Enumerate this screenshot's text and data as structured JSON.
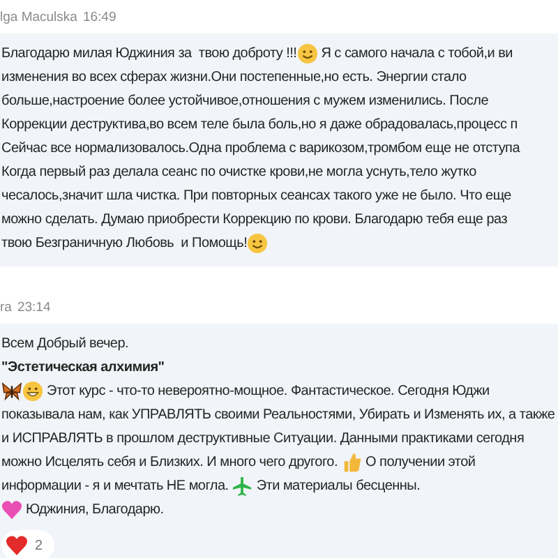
{
  "messages": [
    {
      "sender": "lga Maculska",
      "time": "16:49",
      "lines": [
        [
          {
            "kind": "text",
            "text": "Благодарю милая Юджиния за  твою доброту !!!"
          },
          {
            "kind": "smiley"
          },
          {
            "kind": "text",
            "text": " Я с самого начала с тобой,и ви"
          }
        ],
        [
          {
            "kind": "text",
            "text": "изменения во всех сферах жизни.Они постепенные,но есть. Энергии стало"
          }
        ],
        [
          {
            "kind": "text",
            "text": "больше,настроение более устойчивое,отношения с мужем изменились. После"
          }
        ],
        [
          {
            "kind": "text",
            "text": "Коррекции деструктива,во всем теле была боль,но я даже обрадовалась,процесс п"
          }
        ],
        [
          {
            "kind": "text",
            "text": "Сейчас все нормализовалось.Одна проблема с варикозом,тромбом еще не отступа"
          }
        ],
        [
          {
            "kind": "text",
            "text": "Когда первый раз делала сеанс по очистке крови,не могла уснуть,тело жутко"
          }
        ],
        [
          {
            "kind": "text",
            "text": "чесалось,значит шла чистка. При повторных сеансах такого уже не было. Что еще"
          }
        ],
        [
          {
            "kind": "text",
            "text": "можно сделать. Думаю приобрести Коррекцию по крови. Благодарю тебя еще раз"
          }
        ],
        [
          {
            "kind": "text",
            "text": "твою Безграничную Любовь  и Помощь!"
          },
          {
            "kind": "smiley"
          }
        ]
      ]
    },
    {
      "sender": "ra",
      "time": "23:14",
      "lines": [
        [
          {
            "kind": "text",
            "text": "Всем Добрый вечер."
          }
        ],
        [
          {
            "kind": "bold",
            "text": "\"Эстетическая алхимия\""
          }
        ],
        [
          {
            "kind": "butterfly"
          },
          {
            "kind": "grin"
          },
          {
            "kind": "text",
            "text": " Этот курс - что-то невероятно-мощное. Фантастическое. Сегодня Юджи"
          }
        ],
        [
          {
            "kind": "text",
            "text": "показывала нам, как УПРАВЛЯТЬ своими Реальностями, Убирать и Изменять их, а также"
          }
        ],
        [
          {
            "kind": "text",
            "text": "и ИСПРАВЛЯТЬ в прошлом деструктивные Ситуации. Данными практиками сегодня"
          }
        ],
        [
          {
            "kind": "text",
            "text": "можно Исцелять себя и Близких. И много чего другого. "
          },
          {
            "kind": "thumbsup"
          },
          {
            "kind": "text",
            "text": " О получении этой"
          }
        ],
        [
          {
            "kind": "text",
            "text": "информации - я и мечтать НЕ могла. "
          },
          {
            "kind": "airplane"
          },
          {
            "kind": "text",
            "text": " Эти материалы бесценны."
          }
        ],
        [
          {
            "kind": "heart"
          },
          {
            "kind": "text",
            "text": " Юджиния, Благодарю."
          }
        ]
      ],
      "reactions": [
        {
          "kind": "heart",
          "count": "2"
        }
      ]
    }
  ]
}
